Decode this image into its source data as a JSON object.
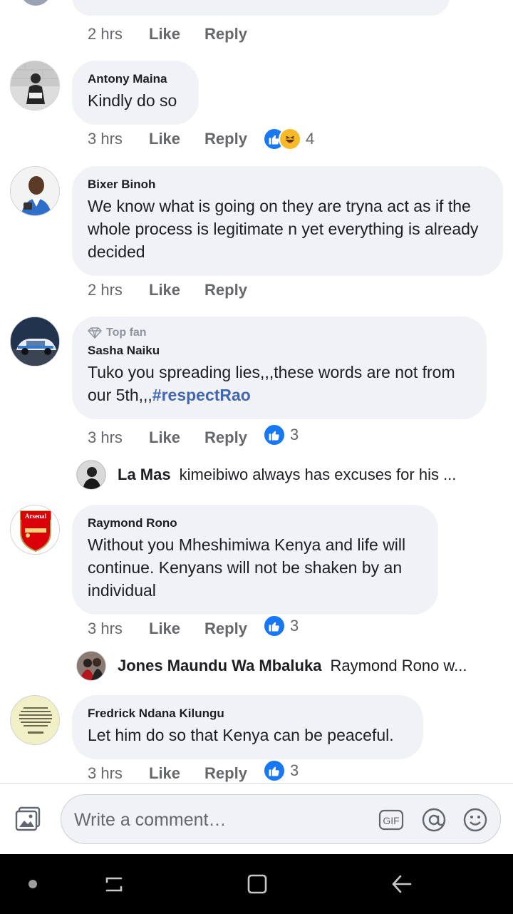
{
  "comments": [
    {
      "time": "2 hrs",
      "like": "Like",
      "reply": "Reply"
    },
    {
      "name": "Antony Maina",
      "text": "Kindly do so",
      "time": "3 hrs",
      "like": "Like",
      "reply": "Reply",
      "reaction_count": "4"
    },
    {
      "name": "Bixer Binoh",
      "text": "We know what is going on they are tryna act as if the whole process is legitimate n yet everything is already decided",
      "time": "2 hrs",
      "like": "Like",
      "reply": "Reply"
    },
    {
      "badge": "Top fan",
      "name": "Sasha Naiku",
      "text": "Tuko you spreading lies,,,these words are not from our 5th,,,",
      "hashtag": "#respectRao",
      "time": "3 hrs",
      "like": "Like",
      "reply": "Reply",
      "reaction_count": "3",
      "reply_preview": {
        "name": "La Mas",
        "text": "kimeibiwo always has excuses for his ..."
      }
    },
    {
      "name": "Raymond Rono",
      "avatar_label": "Arsenal",
      "text": "Without you Mheshimiwa Kenya and life will continue. Kenyans will not be shaken by an individual",
      "time": "3 hrs",
      "like": "Like",
      "reply": "Reply",
      "reaction_count": "3",
      "reply_preview": {
        "name": "Jones Maundu Wa Mbaluka",
        "text": "Raymond Rono w..."
      }
    },
    {
      "name": "Fredrick Ndana Kilungu",
      "text": "Let him do so that Kenya can be peaceful.",
      "time": "3 hrs",
      "like": "Like",
      "reply": "Reply",
      "reaction_count": "3"
    }
  ],
  "composer": {
    "placeholder": "Write a comment…",
    "gif_label": "GIF"
  },
  "icons": {
    "photo": "photo-icon",
    "gif": "gif-icon",
    "mention": "at-sign-icon",
    "emoji": "smiley-icon",
    "like": "thumbs-up-icon",
    "haha": "laughing-face-icon",
    "top_fan": "diamond-icon",
    "nav_dot": "dot-icon",
    "nav_recent": "recent-apps-icon",
    "nav_home": "home-square-icon",
    "nav_back": "back-arrow-icon"
  },
  "colors": {
    "accent": "#1877f2",
    "hashtag": "#4267b2",
    "bubble": "#f0f2f5",
    "meta": "#65676b",
    "haha": "#f7b928",
    "arsenal_red": "#db0007"
  }
}
